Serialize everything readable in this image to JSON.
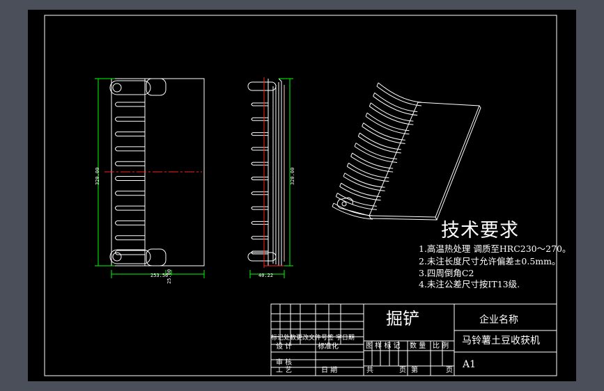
{
  "colors": {
    "background": "#4a4f5a",
    "sheet": "#000000",
    "line": "#ffffff",
    "dimension": "#00ff00",
    "centerline": "#ff0000"
  },
  "dimensions": {
    "front_height": "320.00",
    "front_width": "253.56",
    "front_small": "25.00",
    "side_height": "320.00",
    "side_width": "40.22"
  },
  "tech_requirements": {
    "title": "技术要求",
    "items": [
      "1.高温热处理 调质至HRC230～270。",
      "2.未注长度尺寸允许偏差±0.5mm。",
      "3.四周倒角C2",
      "4.未注公差尺寸按IT13级."
    ]
  },
  "title_block": {
    "part_name": "掘铲",
    "company": "企业名称",
    "product": "马铃薯土豆收获机",
    "revision_row": "标记处数更改文件号签  字日期",
    "design": "设 计",
    "standardize": "标准化",
    "review": "审 核",
    "process": "工 艺",
    "date": "日 期",
    "stage": "图 样 标 记",
    "quantity": "数 量",
    "scale": "比 例",
    "total": "共",
    "sheets": "页",
    "page_no": "第",
    "page": "页",
    "sheet_size": "A1"
  }
}
